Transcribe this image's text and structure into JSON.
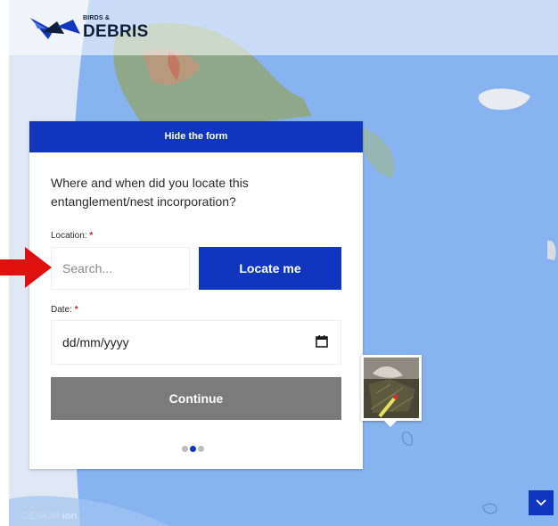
{
  "brand": {
    "small": "BIRDS &",
    "big": "DEBRIS"
  },
  "form": {
    "hide_label": "Hide the form",
    "question": "Where and when did you locate this entanglement/nest incorporation?",
    "location_label": "Location:",
    "required_mark": "*",
    "search_placeholder": "Search...",
    "locate_label": "Locate me",
    "date_label": "Date:",
    "date_placeholder": "dd/mm/yyyy",
    "continue_label": "Continue",
    "steps": {
      "total": 3,
      "current": 2
    }
  },
  "map": {
    "attribution_a": "CESIUM",
    "attribution_b": "ion"
  },
  "colors": {
    "accent": "#1036c0",
    "disabled": "#7b7b7b",
    "required": "#d11a1a",
    "arrow": "#e01010",
    "ocean": "#87b4f0",
    "dot_inactive": "#bdbdbd",
    "dot_active": "#1036c0"
  },
  "icons": {
    "calendar": "calendar-icon",
    "chevron": "chevron-down-icon",
    "arrow": "arrow-right-icon"
  }
}
